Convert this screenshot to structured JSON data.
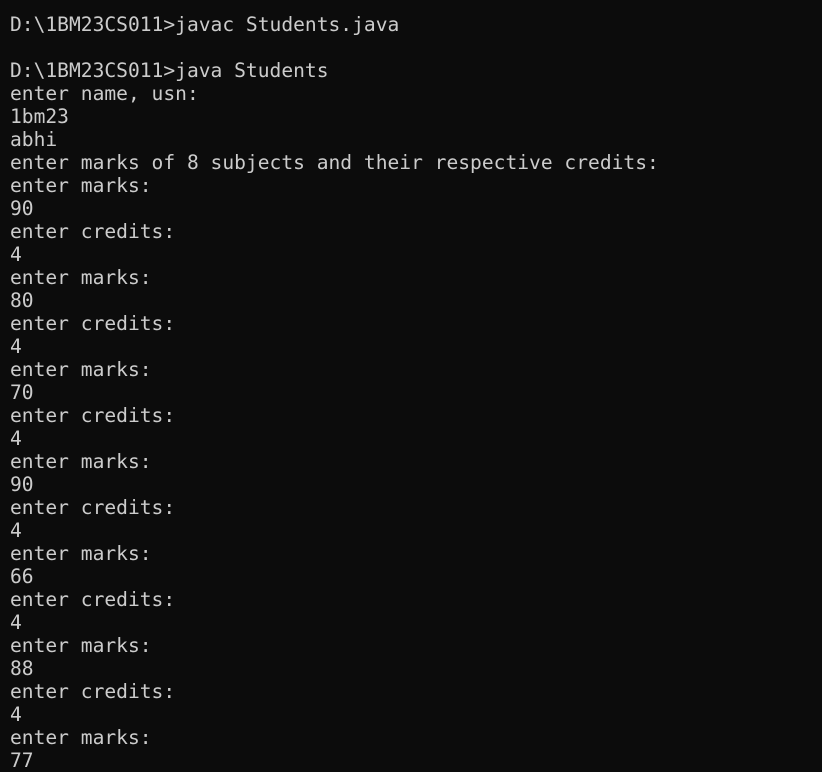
{
  "terminal": {
    "lines": [
      "D:\\1BM23CS011>javac Students.java",
      "",
      "D:\\1BM23CS011>java Students",
      "enter name, usn:",
      "1bm23",
      "abhi",
      "enter marks of 8 subjects and their respective credits:",
      "enter marks:",
      "90",
      "enter credits:",
      "4",
      "enter marks:",
      "80",
      "enter credits:",
      "4",
      "enter marks:",
      "70",
      "enter credits:",
      "4",
      "enter marks:",
      "90",
      "enter credits:",
      "4",
      "enter marks:",
      "66",
      "enter credits:",
      "4",
      "enter marks:",
      "88",
      "enter credits:",
      "4",
      "enter marks:",
      "77"
    ],
    "colors": {
      "background": "#0c0c0c",
      "text": "#cccccc"
    }
  }
}
